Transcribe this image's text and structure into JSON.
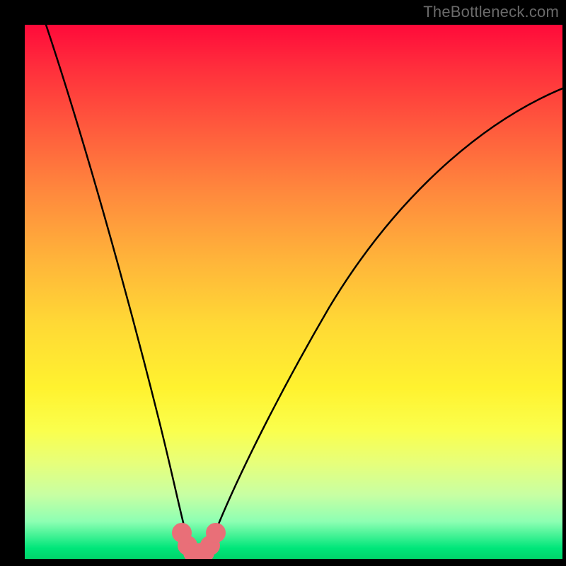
{
  "watermark": "TheBottleneck.com",
  "chart_data": {
    "type": "line",
    "title": "",
    "xlabel": "",
    "ylabel": "",
    "xlim": [
      0,
      100
    ],
    "ylim": [
      0,
      100
    ],
    "background": "red-yellow-green vertical gradient",
    "series": [
      {
        "name": "bottleneck-curve",
        "x": [
          4,
          8,
          12,
          16,
          20,
          24,
          27,
          29,
          30,
          31,
          32,
          33,
          34,
          35,
          38,
          42,
          48,
          56,
          66,
          78,
          92,
          100
        ],
        "y": [
          100,
          86,
          72,
          58,
          43,
          27,
          12,
          4,
          1.5,
          1,
          1,
          1,
          1.5,
          3,
          10,
          20,
          34,
          48,
          62,
          74,
          84,
          89
        ]
      },
      {
        "name": "bottom-marker-arc",
        "x": [
          29,
          30,
          31,
          32,
          33,
          34,
          35
        ],
        "y": [
          4,
          2,
          1.2,
          1,
          1.2,
          2,
          4
        ]
      }
    ],
    "annotations": []
  },
  "colors": {
    "frame": "#000000",
    "curve": "#000000",
    "marker": "#e96f78",
    "watermark": "#6a6a6a"
  }
}
